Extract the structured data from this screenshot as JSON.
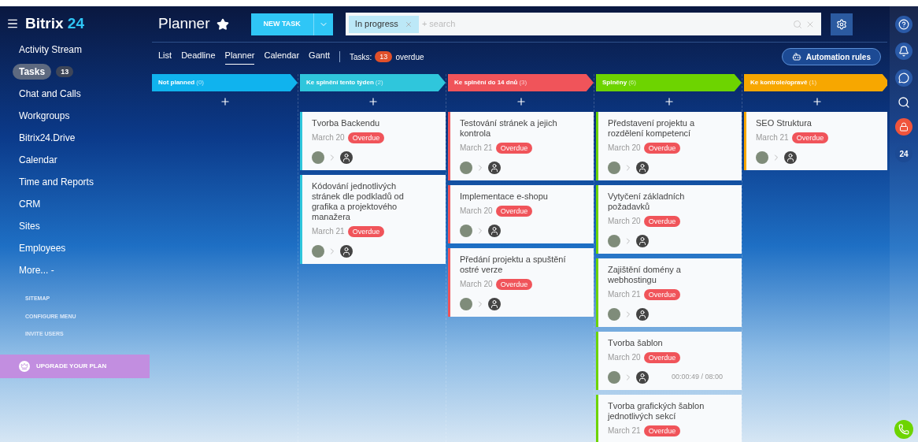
{
  "sidebar": {
    "logo_main": "Bitrix",
    "logo_accent": "24",
    "items": [
      {
        "label": "Activity Stream",
        "selected": false
      },
      {
        "label": "Tasks",
        "selected": true,
        "count": "13"
      },
      {
        "label": "Chat and Calls",
        "selected": false
      },
      {
        "label": "Workgroups",
        "selected": false
      },
      {
        "label": "Bitrix24.Drive",
        "selected": false
      },
      {
        "label": "Calendar",
        "selected": false
      },
      {
        "label": "Time and Reports",
        "selected": false
      },
      {
        "label": "CRM",
        "selected": false
      },
      {
        "label": "Sites",
        "selected": false
      },
      {
        "label": "Employees",
        "selected": false
      },
      {
        "label": "More... -",
        "selected": false
      }
    ],
    "links": [
      "SITEMAP",
      "CONFIGURE MENU",
      "INVITE USERS"
    ],
    "upgrade": "UPGRADE YOUR PLAN"
  },
  "header": {
    "title": "Planner",
    "new_task": "NEW TASK",
    "filter_chip": "In progress",
    "search_placeholder": "+ search"
  },
  "view_tabs": [
    {
      "label": "List",
      "selected": false
    },
    {
      "label": "Deadline",
      "selected": false
    },
    {
      "label": "Planner",
      "selected": true
    },
    {
      "label": "Calendar",
      "selected": false
    },
    {
      "label": "Gantt",
      "selected": false
    }
  ],
  "counter": {
    "label": "Tasks:",
    "count": "13",
    "suffix": "overdue"
  },
  "automation": "Automation rules",
  "columns": [
    {
      "title": "Not planned",
      "count": "(0)",
      "color": "#10b3ee"
    },
    {
      "title": "Ke splnění tento týden",
      "count": "(2)",
      "color": "#2fc6dc",
      "cards": [
        {
          "title": "Tvorba Backendu",
          "date": "March 20",
          "badge": "Overdue"
        },
        {
          "title": "Kódování jednotlivých stránek dle podkladů od grafika a projektového manažera",
          "date": "March 21",
          "badge": "Overdue"
        }
      ]
    },
    {
      "title": "Ke splnění do 14 dnů",
      "count": "(3)",
      "color": "#f0545a",
      "cards": [
        {
          "title": "Testování stránek a jejich kontrola",
          "date": "March 21",
          "badge": "Overdue"
        },
        {
          "title": "Implementace e-shopu",
          "date": "March 20",
          "badge": "Overdue"
        },
        {
          "title": "Předání projektu a spuštění ostré verze",
          "date": "March 20",
          "badge": "Overdue"
        }
      ]
    },
    {
      "title": "Splněny",
      "count": "(6)",
      "color": "#6dd400",
      "cards": [
        {
          "title": "Představení projektu a rozdělení kompetencí",
          "date": "March 20",
          "badge": "Overdue"
        },
        {
          "title": "Vytyčení základních požadavků",
          "date": "March 20",
          "badge": "Overdue"
        },
        {
          "title": "Zajištění domény a webhostingu",
          "date": "March 21",
          "badge": "Overdue"
        },
        {
          "title": "Tvorba šablon",
          "date": "March 20",
          "badge": "Overdue",
          "timer": "00:00:49 / 08:00"
        },
        {
          "title": "Tvorba grafických šablon jednotlivých sekcí",
          "date": "March 21",
          "badge": "Overdue"
        }
      ]
    },
    {
      "title": "Ke kontrole/opravě",
      "count": "(1)",
      "color": "#f7a700",
      "cards": [
        {
          "title": "SEO Struktura",
          "date": "March 21",
          "badge": "Overdue"
        }
      ]
    }
  ],
  "rail_badge": "24"
}
